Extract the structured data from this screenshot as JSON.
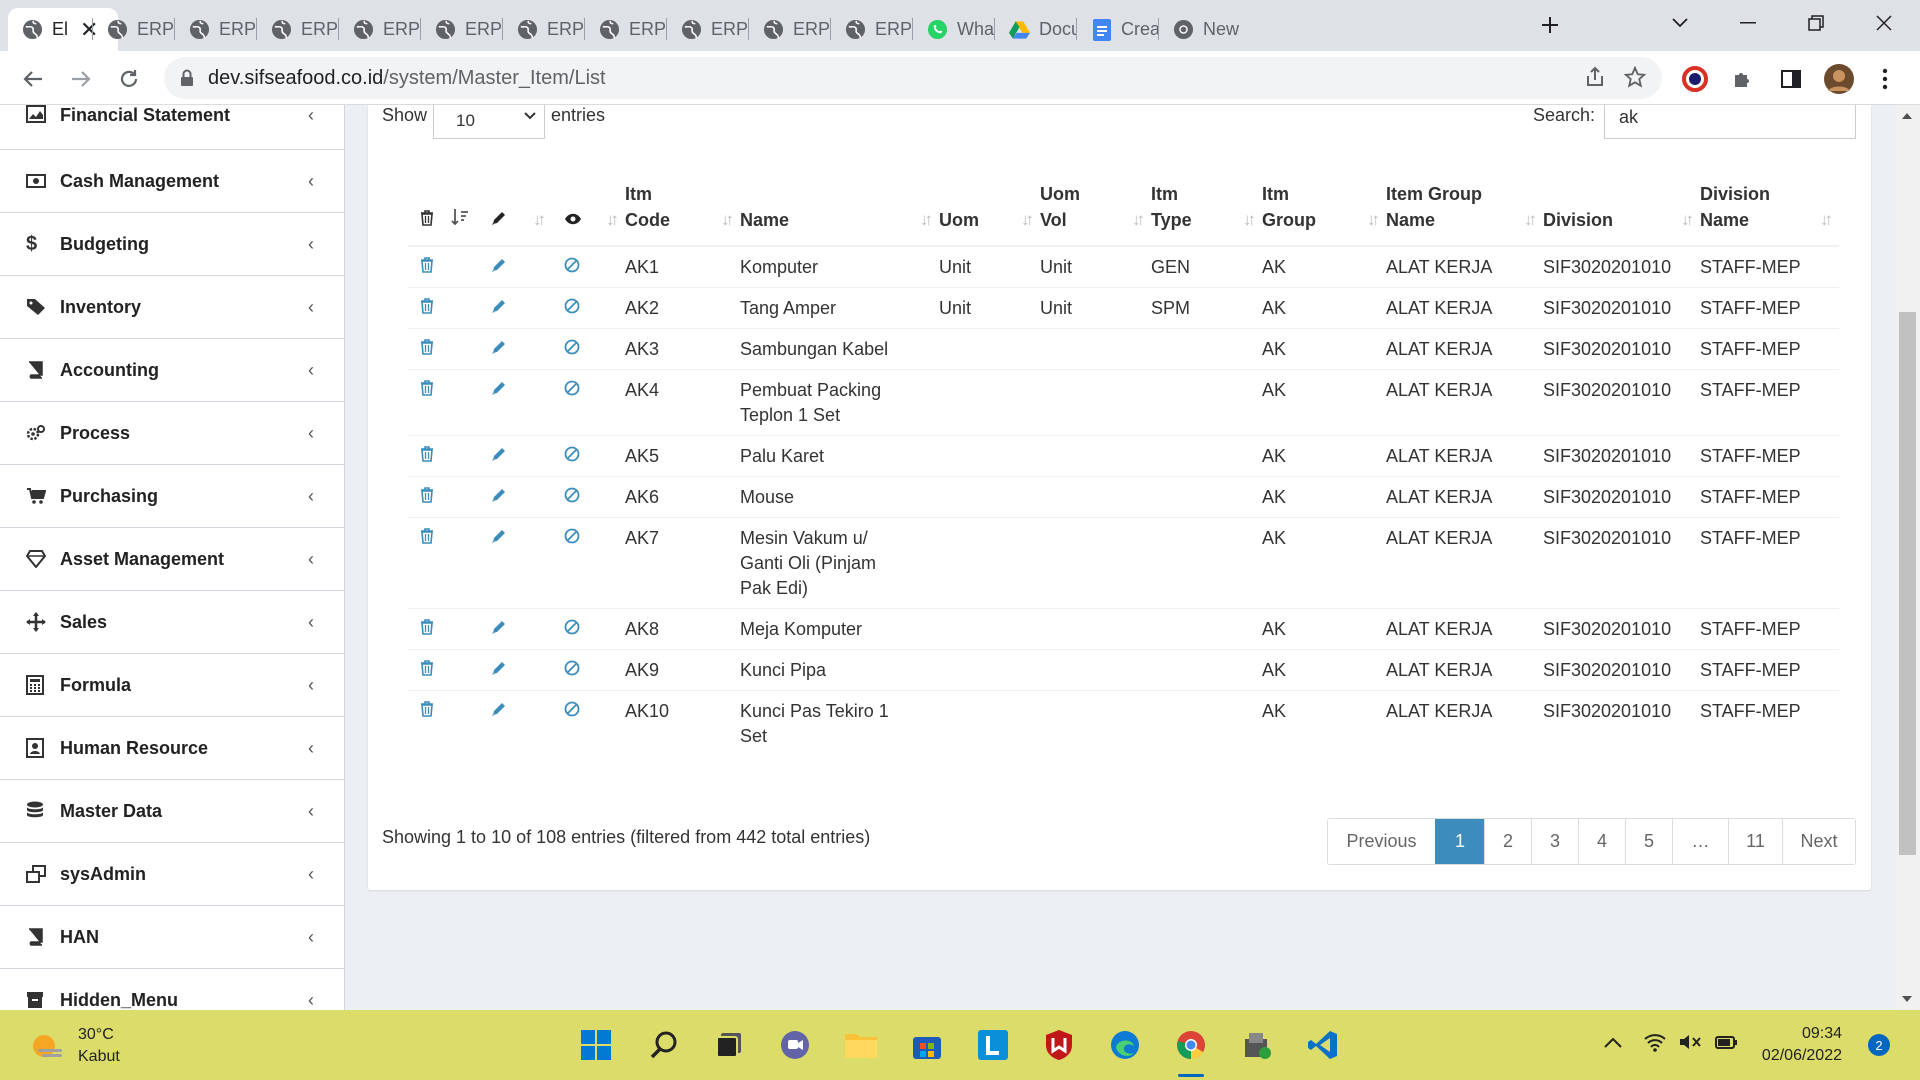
{
  "browser": {
    "tabs": [
      {
        "label": "El",
        "icon": "globe-icon",
        "active": true
      },
      {
        "label": "ERP:S",
        "icon": "globe-icon"
      },
      {
        "label": "ERP:S",
        "icon": "globe-icon"
      },
      {
        "label": "ERP:S",
        "icon": "globe-icon"
      },
      {
        "label": "ERP:U",
        "icon": "globe-icon"
      },
      {
        "label": "ERP:c",
        "icon": "globe-icon"
      },
      {
        "label": "ERP:c",
        "icon": "globe-icon"
      },
      {
        "label": "ERP:c",
        "icon": "globe-icon"
      },
      {
        "label": "ERP:U",
        "icon": "globe-icon"
      },
      {
        "label": "ERP:I",
        "icon": "globe-icon"
      },
      {
        "label": "ERP:I",
        "icon": "globe-icon"
      },
      {
        "label": "What",
        "icon": "whatsapp-icon"
      },
      {
        "label": "Docu",
        "icon": "drive-icon"
      },
      {
        "label": "Crea",
        "icon": "docs-icon"
      },
      {
        "label": "New",
        "icon": "chrome-icon"
      }
    ],
    "url_host": "dev.sifseafood.co.id",
    "url_path": "/system/Master_Item/List"
  },
  "sidebar": {
    "items": [
      {
        "label": "Financial Statement",
        "icon": "chart-icon"
      },
      {
        "label": "Cash Management",
        "icon": "money-icon"
      },
      {
        "label": "Budgeting",
        "icon": "dollar-icon"
      },
      {
        "label": "Inventory",
        "icon": "tag-icon"
      },
      {
        "label": "Accounting",
        "icon": "book-icon"
      },
      {
        "label": "Process",
        "icon": "cogs-icon"
      },
      {
        "label": "Purchasing",
        "icon": "cart-icon"
      },
      {
        "label": "Asset Management",
        "icon": "diamond-icon"
      },
      {
        "label": "Sales",
        "icon": "move-icon"
      },
      {
        "label": "Formula",
        "icon": "calculator-icon"
      },
      {
        "label": "Human Resource",
        "icon": "contact-icon"
      },
      {
        "label": "Master Data",
        "icon": "database-icon"
      },
      {
        "label": "sysAdmin",
        "icon": "windows-icon"
      },
      {
        "label": "HAN",
        "icon": "book-icon"
      },
      {
        "label": "Hidden_Menu",
        "icon": "archive-icon"
      }
    ]
  },
  "controls": {
    "show_label": "Show",
    "entries_value": "10",
    "entries_label": "entries",
    "search_label": "Search:",
    "search_value": "ak"
  },
  "table": {
    "headers": [
      "Itm Code",
      "Name",
      "Uom",
      "Uom Vol",
      "Itm Type",
      "Itm Group",
      "Item Group Name",
      "Division",
      "Division Name"
    ],
    "rows": [
      {
        "code": "AK1",
        "name": "Komputer",
        "uom": "Unit",
        "uom_vol": "Unit",
        "type": "GEN",
        "group": "AK",
        "group_name": "ALAT KERJA",
        "division": "SIF3020201010",
        "division_name": "STAFF-MEP"
      },
      {
        "code": "AK2",
        "name": "Tang Amper",
        "uom": "Unit",
        "uom_vol": "Unit",
        "type": "SPM",
        "group": "AK",
        "group_name": "ALAT KERJA",
        "division": "SIF3020201010",
        "division_name": "STAFF-MEP"
      },
      {
        "code": "AK3",
        "name": "Sambungan Kabel",
        "uom": "",
        "uom_vol": "",
        "type": "",
        "group": "AK",
        "group_name": "ALAT KERJA",
        "division": "SIF3020201010",
        "division_name": "STAFF-MEP"
      },
      {
        "code": "AK4",
        "name": "Pembuat Packing Teplon 1 Set",
        "uom": "",
        "uom_vol": "",
        "type": "",
        "group": "AK",
        "group_name": "ALAT KERJA",
        "division": "SIF3020201010",
        "division_name": "STAFF-MEP"
      },
      {
        "code": "AK5",
        "name": "Palu Karet",
        "uom": "",
        "uom_vol": "",
        "type": "",
        "group": "AK",
        "group_name": "ALAT KERJA",
        "division": "SIF3020201010",
        "division_name": "STAFF-MEP"
      },
      {
        "code": "AK6",
        "name": "Mouse",
        "uom": "",
        "uom_vol": "",
        "type": "",
        "group": "AK",
        "group_name": "ALAT KERJA",
        "division": "SIF3020201010",
        "division_name": "STAFF-MEP"
      },
      {
        "code": "AK7",
        "name": "Mesin Vakum u/ Ganti Oli (Pinjam Pak Edi)",
        "uom": "",
        "uom_vol": "",
        "type": "",
        "group": "AK",
        "group_name": "ALAT KERJA",
        "division": "SIF3020201010",
        "division_name": "STAFF-MEP"
      },
      {
        "code": "AK8",
        "name": "Meja Komputer",
        "uom": "",
        "uom_vol": "",
        "type": "",
        "group": "AK",
        "group_name": "ALAT KERJA",
        "division": "SIF3020201010",
        "division_name": "STAFF-MEP"
      },
      {
        "code": "AK9",
        "name": "Kunci Pipa",
        "uom": "",
        "uom_vol": "",
        "type": "",
        "group": "AK",
        "group_name": "ALAT KERJA",
        "division": "SIF3020201010",
        "division_name": "STAFF-MEP"
      },
      {
        "code": "AK10",
        "name": "Kunci Pas Tekiro 1 Set",
        "uom": "",
        "uom_vol": "",
        "type": "",
        "group": "AK",
        "group_name": "ALAT KERJA",
        "division": "SIF3020201010",
        "division_name": "STAFF-MEP"
      }
    ]
  },
  "footer": {
    "info": "Showing 1 to 10 of 108 entries (filtered from 442 total entries)",
    "pages": [
      "Previous",
      "1",
      "2",
      "3",
      "4",
      "5",
      "…",
      "11",
      "Next"
    ],
    "active_page": "1"
  },
  "taskbar": {
    "temperature": "30°C",
    "weather": "Kabut",
    "time": "09:34",
    "date": "02/06/2022",
    "notifications": "2"
  },
  "colors": {
    "accent": "#3c8dbc",
    "taskbar": "#dcdc6a",
    "sidebar_border": "#d2d6de"
  }
}
